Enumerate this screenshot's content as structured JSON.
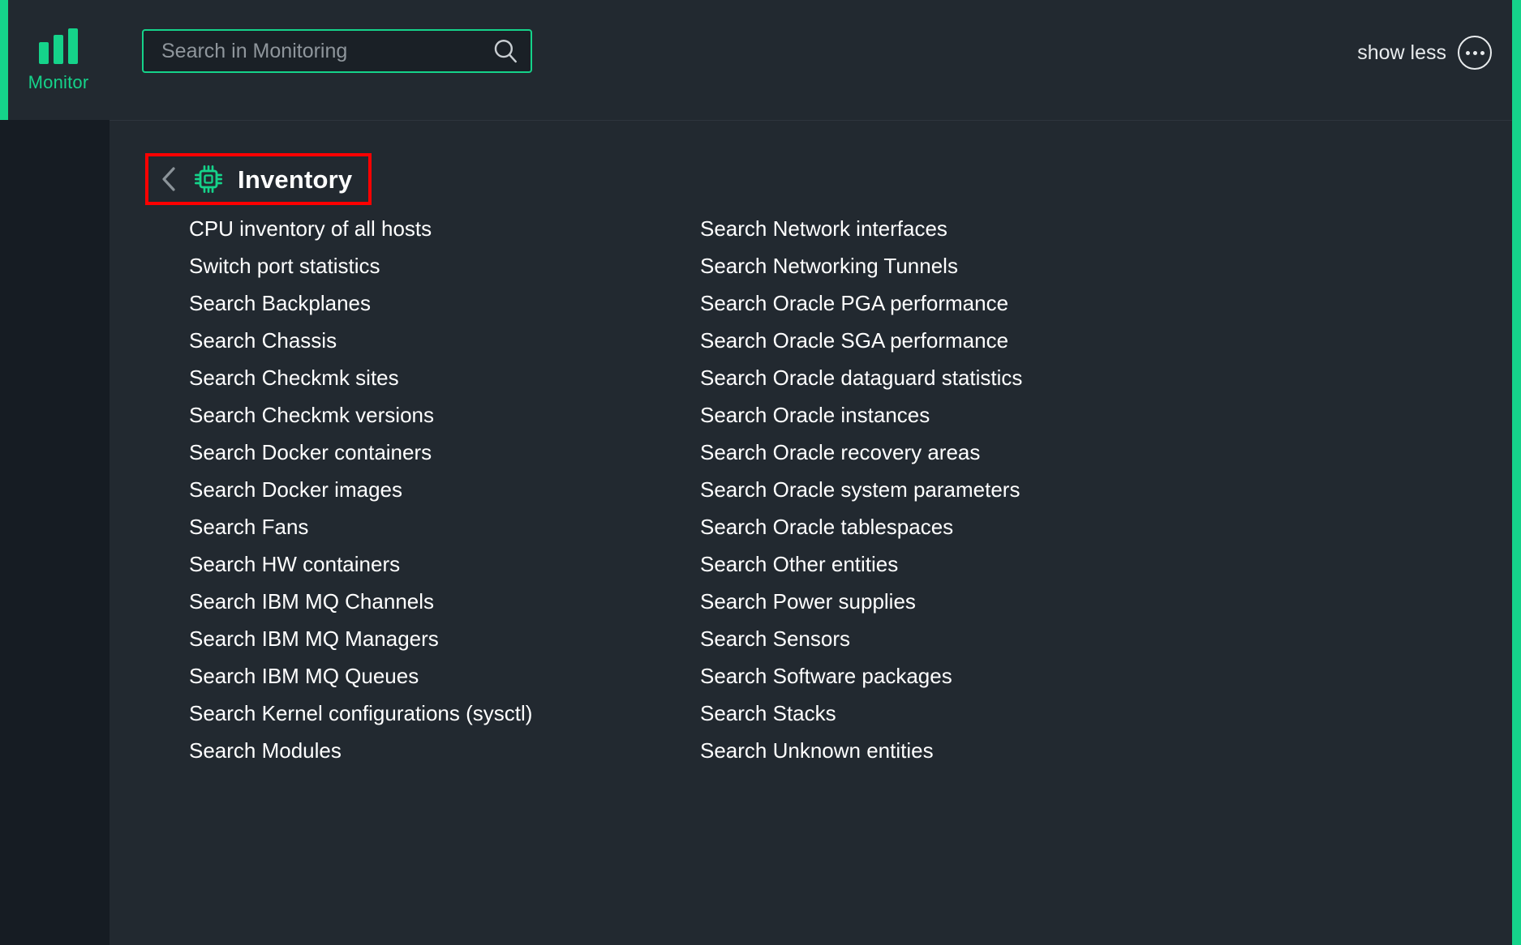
{
  "header": {
    "nav": {
      "icon": "bar-chart-icon",
      "label": "Monitor"
    },
    "search": {
      "placeholder": "Search in Monitoring",
      "value": "",
      "icon": "search-icon"
    },
    "show_less": {
      "label": "show less",
      "icon": "ellipsis-circle-icon"
    }
  },
  "section": {
    "back_icon": "chevron-left-icon",
    "icon": "cpu-chip-icon",
    "title": "Inventory",
    "highlight_color": "#FF0000",
    "icon_color": "#15D38A"
  },
  "columns": {
    "left": [
      "CPU inventory of all hosts",
      "Switch port statistics",
      "Search Backplanes",
      "Search Chassis",
      "Search Checkmk sites",
      "Search Checkmk versions",
      "Search Docker containers",
      "Search Docker images",
      "Search Fans",
      "Search HW containers",
      "Search IBM MQ Channels",
      "Search IBM MQ Managers",
      "Search IBM MQ Queues",
      "Search Kernel configurations (sysctl)",
      "Search Modules"
    ],
    "right": [
      "Search Network interfaces",
      "Search Networking Tunnels",
      "Search Oracle PGA performance",
      "Search Oracle SGA performance",
      "Search Oracle dataguard statistics",
      "Search Oracle instances",
      "Search Oracle recovery areas",
      "Search Oracle system parameters",
      "Search Oracle tablespaces",
      "Search Other entities",
      "Search Power supplies",
      "Search Sensors",
      "Search Software packages",
      "Search Stacks",
      "Search Unknown entities"
    ]
  },
  "theme": {
    "accent": "#15D38A",
    "background": "#222930",
    "sidebar_background": "#161c23",
    "text": "#ffffff"
  }
}
